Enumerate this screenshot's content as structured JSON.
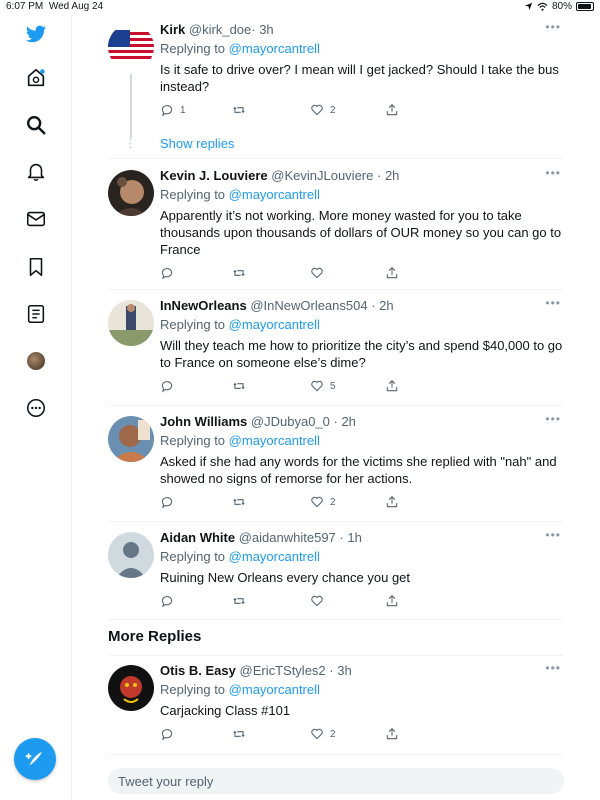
{
  "status": {
    "time": "6:07 PM",
    "date": "Wed Aug 24",
    "battery": "80%",
    "battery_level": 0.8
  },
  "sidebar": {
    "items": [
      {
        "icon": "twitter-bird-icon"
      },
      {
        "icon": "home-icon"
      },
      {
        "icon": "search-icon"
      },
      {
        "icon": "bell-icon"
      },
      {
        "icon": "mail-icon"
      },
      {
        "icon": "bookmark-icon"
      },
      {
        "icon": "lists-icon"
      },
      {
        "icon": "profile-avatar"
      },
      {
        "icon": "more-icon"
      }
    ],
    "compose_icon": "compose-icon"
  },
  "tweets": [
    {
      "name": "Kirk",
      "handle": "@kirk_doe",
      "time": "· 3h",
      "replying": "Replying to",
      "mention": "@mayorcantrell",
      "text": "Is it safe to drive over? I mean will I get jacked? Should I take the bus instead?",
      "reply_count": "1",
      "retweet_count": "",
      "like_count": "2",
      "avatar_color": "#1a3f8f"
    },
    {
      "name": "Kevin J. Louviere",
      "handle": "@KevinJLouviere",
      "time": "· 2h",
      "replying": "Replying to",
      "mention": "@mayorcantrell",
      "text": "Apparently it’s not working. More money wasted for you to take thousands upon thousands of dollars of OUR money so you can go to France",
      "reply_count": "",
      "retweet_count": "",
      "like_count": "",
      "avatar_color": "#5a4636"
    },
    {
      "name": "InNewOrleans",
      "handle": "@InNewOrleans504",
      "time": "· 2h",
      "replying": "Replying to",
      "mention": "@mayorcantrell",
      "text": "Will they teach me how to prioritize the city’s and spend $40,000 to go to France on someone else’s dime?",
      "reply_count": "",
      "retweet_count": "",
      "like_count": "5",
      "avatar_color": "#6b7a52"
    },
    {
      "name": "John Williams",
      "handle": "@JDubya0_0",
      "time": "· 2h",
      "replying": "Replying to",
      "mention": "@mayorcantrell",
      "text": "Asked if she had any words for the victims she replied with \"nah\" and showed no signs of remorse for her actions.",
      "reply_count": "",
      "retweet_count": "",
      "like_count": "2",
      "avatar_color": "#8a5a3c"
    },
    {
      "name": "Aidan White",
      "handle": "@aidanwhite597",
      "time": "· 1h",
      "replying": "Replying to",
      "mention": "@mayorcantrell",
      "text": "Ruining New Orleans every chance you get",
      "reply_count": "",
      "retweet_count": "",
      "like_count": "",
      "avatar_color": "#cfd9de"
    },
    {
      "name": "Otis B. Easy",
      "handle": "@EricTStyles2",
      "time": "· 3h",
      "replying": "Replying to",
      "mention": "@mayorcantrell",
      "text": "Carjacking Class #101",
      "reply_count": "",
      "retweet_count": "",
      "like_count": "2",
      "avatar_color": "#111111"
    }
  ],
  "show_replies": "Show replies",
  "more_replies_title": "More Replies",
  "reply_placeholder": "Tweet your reply",
  "colors": {
    "accent": "#1d9bf0",
    "text": "#0f1419",
    "muted": "#536471",
    "divider": "#eff3f4"
  }
}
